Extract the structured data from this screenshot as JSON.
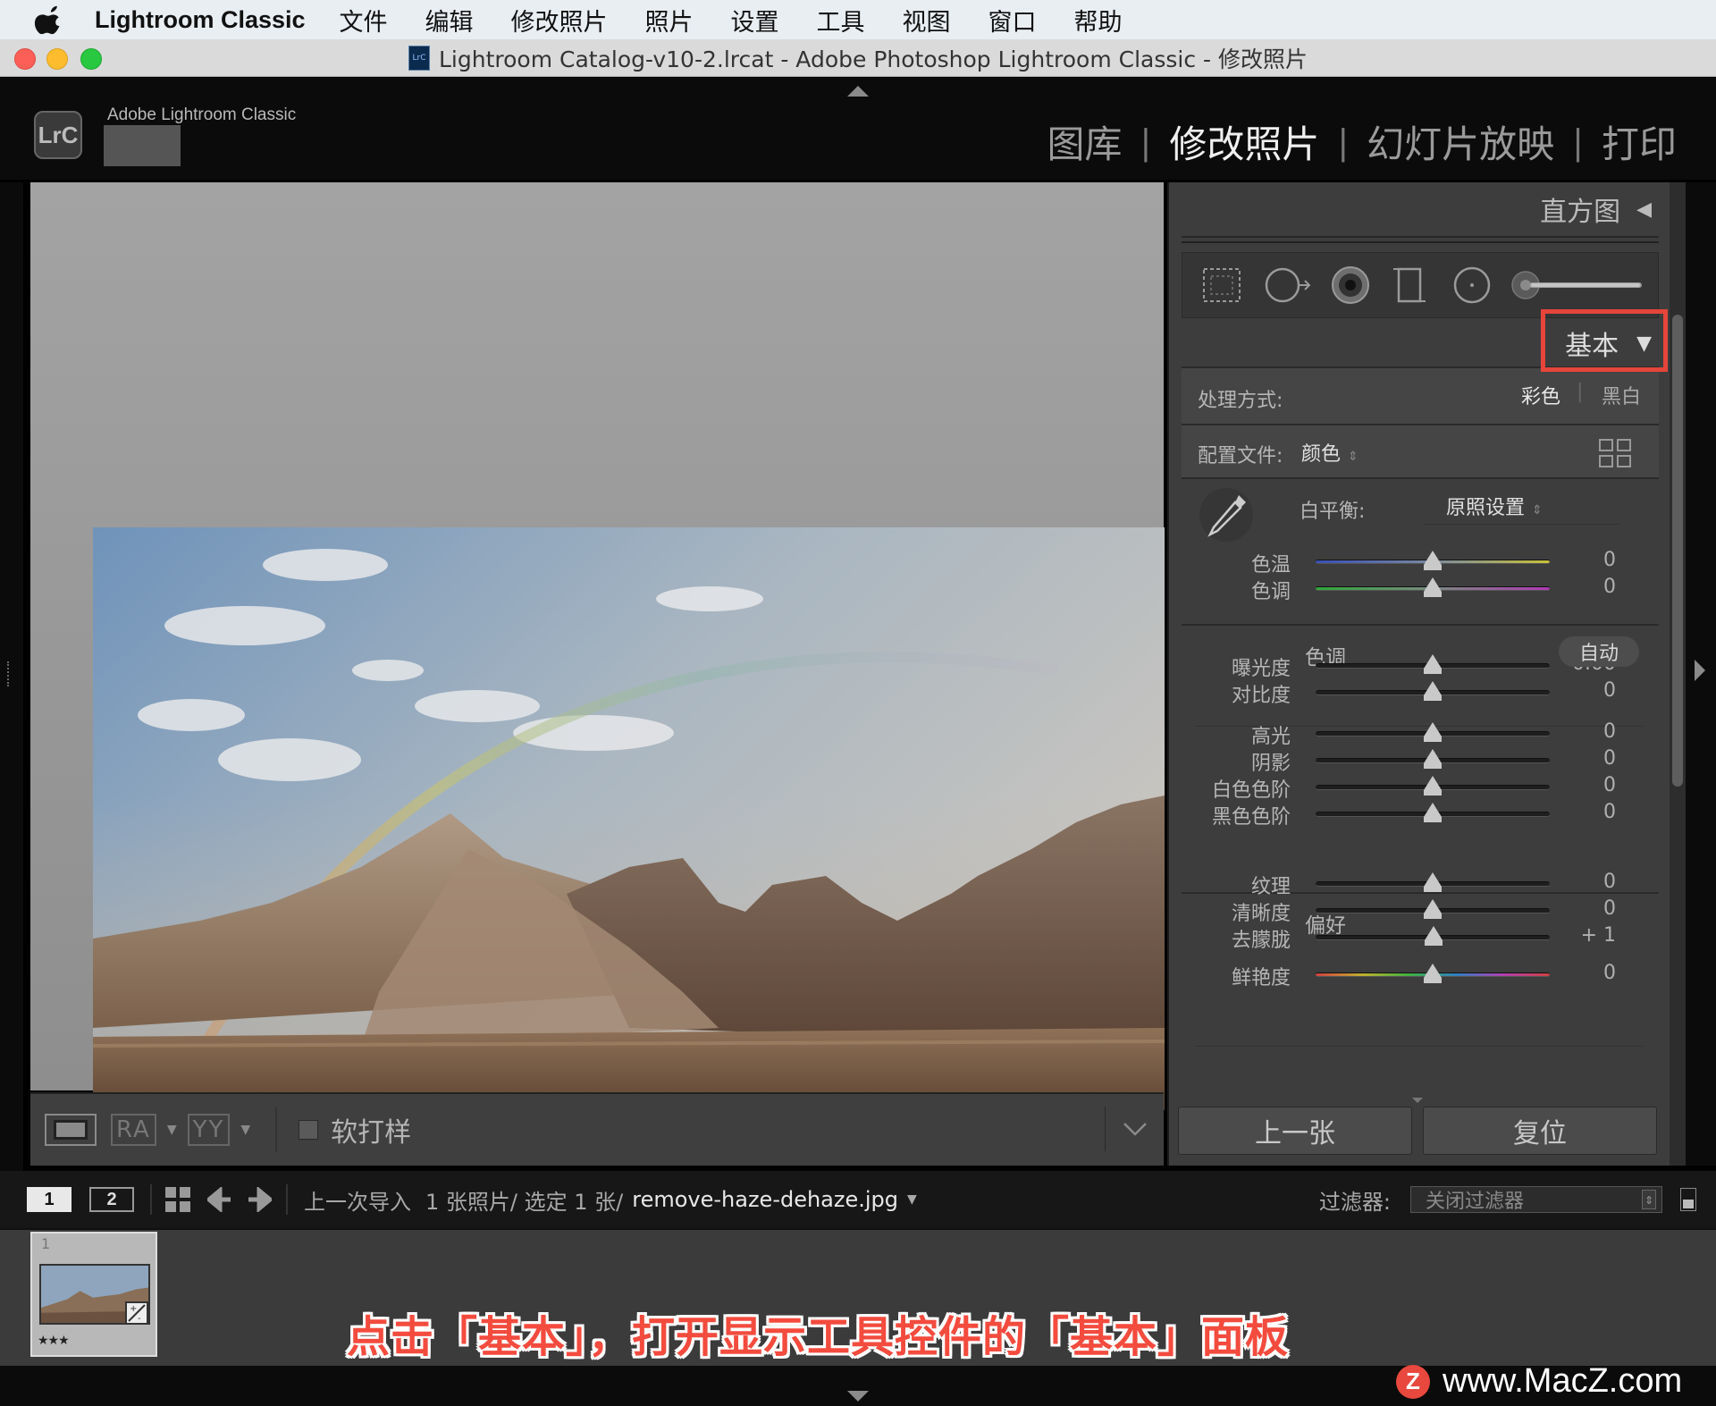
{
  "menubar": {
    "app_name": "Lightroom Classic",
    "items": [
      "文件",
      "编辑",
      "修改照片",
      "照片",
      "设置",
      "工具",
      "视图",
      "窗口",
      "帮助"
    ]
  },
  "titlebar": {
    "doc_icon_text": "LrC",
    "title": "Lightroom Catalog-v10-2.lrcat - Adobe Photoshop Lightroom Classic - 修改照片"
  },
  "branding": {
    "logo": "LrC",
    "name": "Adobe Lightroom Classic"
  },
  "modules": {
    "items": [
      "图库",
      "修改照片",
      "幻灯片放映",
      "打印"
    ],
    "separator": "|",
    "active": "修改照片"
  },
  "toolbar": {
    "compare_label": "RA",
    "survey_label": "YY",
    "soft_proof_label": "软打样",
    "soft_proof_checked": false
  },
  "right_panel": {
    "histogram_label": "直方图",
    "histogram_icon": "left-triangle-icon",
    "tools": [
      "crop-overlay-icon",
      "spot-removal-icon",
      "red-eye-icon",
      "graduated-filter-icon",
      "radial-filter-icon",
      "adjustment-brush-icon"
    ],
    "basic_label": "基本",
    "basic_icon": "down-triangle-icon",
    "treatment": {
      "label": "处理方式:",
      "color": "彩色",
      "bw": "黑白",
      "separator": "|"
    },
    "profile": {
      "label": "配置文件:",
      "value": "颜色",
      "browser_icon": "grid-icon"
    },
    "white_balance": {
      "label": "白平衡:",
      "value": "原照设置",
      "picker_icon": "eyedropper-icon"
    },
    "wb_sliders": [
      {
        "label": "色温",
        "value": "0",
        "level": 0.5,
        "track": "temp"
      },
      {
        "label": "色调",
        "value": "0",
        "level": 0.5,
        "track": "tint"
      }
    ],
    "tone": {
      "title": "色调",
      "auto_label": "自动"
    },
    "tone_sliders_a": [
      {
        "label": "曝光度",
        "value": "0.00",
        "level": 0.5
      },
      {
        "label": "对比度",
        "value": "0",
        "level": 0.5
      }
    ],
    "tone_sliders_b": [
      {
        "label": "高光",
        "value": "0",
        "level": 0.5
      },
      {
        "label": "阴影",
        "value": "0",
        "level": 0.5
      },
      {
        "label": "白色色阶",
        "value": "0",
        "level": 0.5
      },
      {
        "label": "黑色色阶",
        "value": "0",
        "level": 0.5
      }
    ],
    "presence": {
      "title": "偏好"
    },
    "presence_sliders": [
      {
        "label": "纹理",
        "value": "0",
        "level": 0.5
      },
      {
        "label": "清晰度",
        "value": "0",
        "level": 0.5
      },
      {
        "label": "去朦胧",
        "value": "+ 1",
        "level": 0.505
      }
    ],
    "vibrance": {
      "label": "鲜艳度",
      "value": "0",
      "level": 0.5
    },
    "prev_button": "上一张",
    "reset_button": "复位"
  },
  "filmstrip_bar": {
    "view1": "1",
    "view2": "2",
    "source": "上一次导入",
    "count": "1 张照片/ 选定 1 张/",
    "filename": "remove-haze-dehaze.jpg",
    "filter_label": "过滤器:",
    "filter_value": "关闭过滤器"
  },
  "filmstrip": {
    "thumb_index": "1",
    "thumb_rating": "★★★"
  },
  "caption": "点击「基本」，打开显示工具控件的「基本」面板",
  "watermark": {
    "logo": "Z",
    "text": "www.MacZ.com"
  },
  "colors": {
    "highlight_box": "#e5453b",
    "caption": "#f34b3e"
  }
}
